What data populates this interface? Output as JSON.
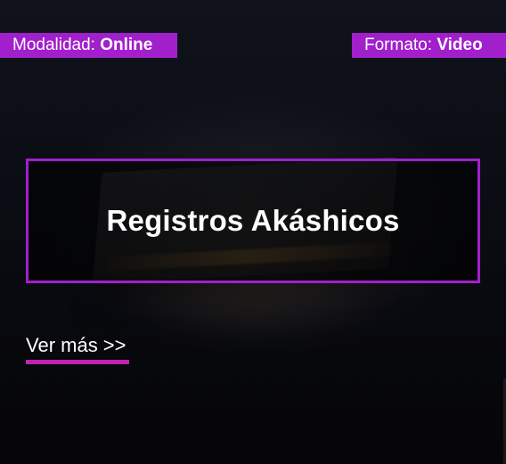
{
  "badges": {
    "modalidad_label": "Modalidad:",
    "modalidad_value": "Online",
    "formato_label": "Formato:",
    "formato_value": "Video"
  },
  "card": {
    "title": "Registros Akáshicos"
  },
  "cta": {
    "label": "Ver más >>"
  },
  "colors": {
    "accent": "#a21fcc",
    "underline": "#c21fb3",
    "background": "#07080c"
  },
  "icons": {
    "background_image": "book-image"
  }
}
